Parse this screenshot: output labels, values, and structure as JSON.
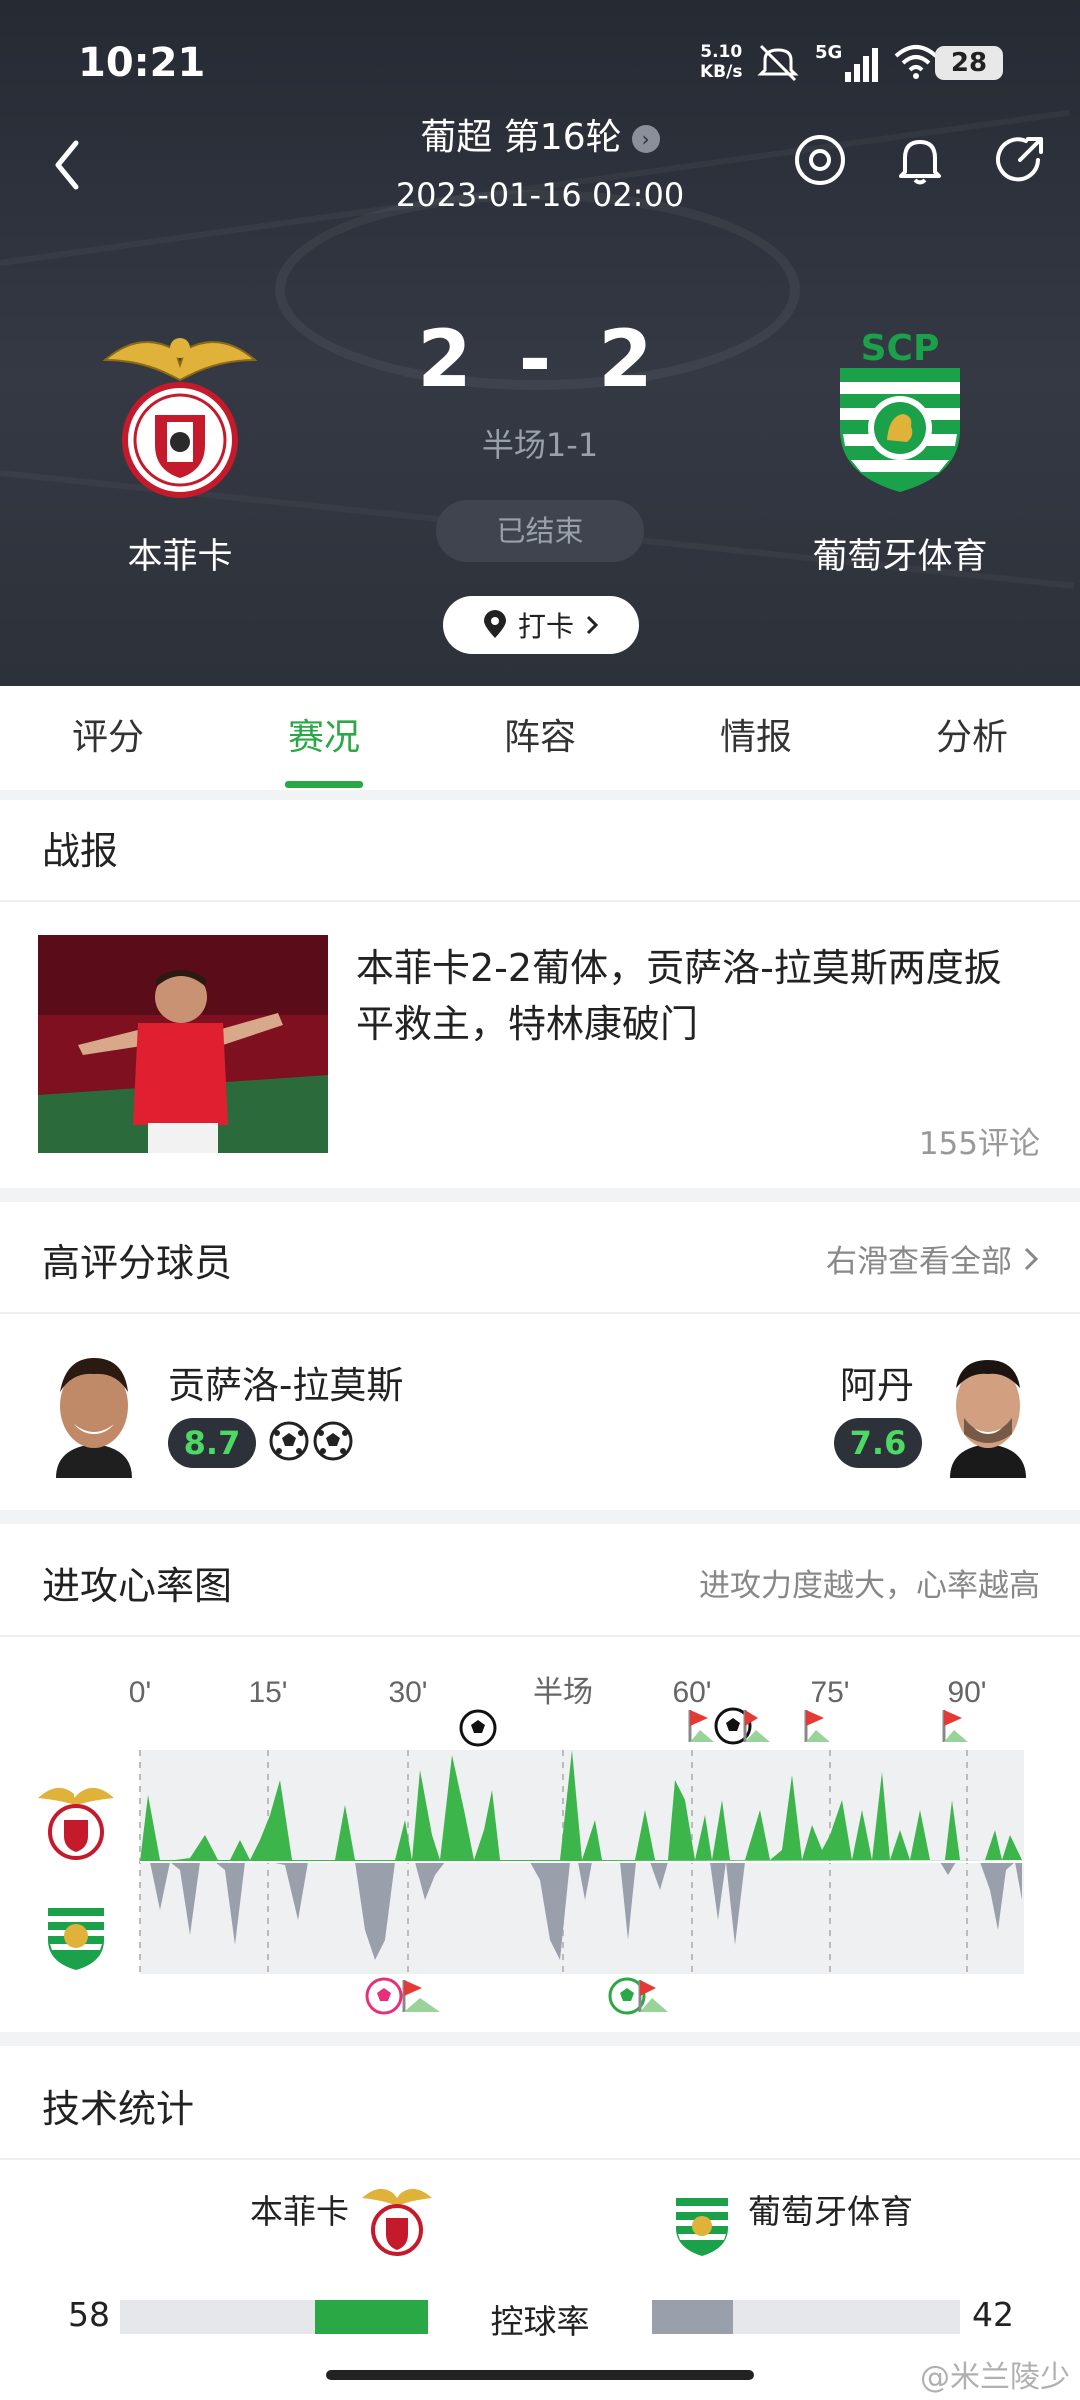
{
  "status_bar": {
    "time": "10:21",
    "net_speed_value": "5.10",
    "net_speed_unit": "KB/s",
    "network": "5G",
    "battery": "28"
  },
  "match": {
    "league": "葡超 第16轮",
    "date": "2023-01-16 02:00",
    "score": "2 - 2",
    "halftime": "半场1-1",
    "status": "已结束",
    "checkin": "打卡",
    "home_team": "本菲卡",
    "away_team": "葡萄牙体育",
    "away_logo_text": "SCP"
  },
  "tabs": [
    {
      "label": "评分"
    },
    {
      "label": "赛况",
      "active": true
    },
    {
      "label": "阵容"
    },
    {
      "label": "情报"
    },
    {
      "label": "分析"
    }
  ],
  "report": {
    "title": "战报",
    "headline": "本菲卡2-2葡体，贡萨洛-拉莫斯两度扳平救主，特林康破门",
    "comments": "155评论"
  },
  "top_players": {
    "title": "高评分球员",
    "see_all": "右滑查看全部",
    "home": {
      "name": "贡萨洛-拉莫斯",
      "rating": "8.7",
      "goals": 2
    },
    "away": {
      "name": "阿丹",
      "rating": "7.6"
    }
  },
  "momentum": {
    "title": "进攻心率图",
    "hint": "进攻力度越大，心率越高",
    "ticks": [
      "0'",
      "15'",
      "30'",
      "半场",
      "60'",
      "75'",
      "90'"
    ]
  },
  "tech_stats": {
    "title": "技术统计",
    "home_team": "本菲卡",
    "away_team": "葡萄牙体育",
    "possession": {
      "label": "控球率",
      "home": 58,
      "away": 42
    }
  },
  "colors": {
    "accent": "#2aa845",
    "away_bar": "#9aa0ab"
  },
  "watermark": "@米兰陵少"
}
